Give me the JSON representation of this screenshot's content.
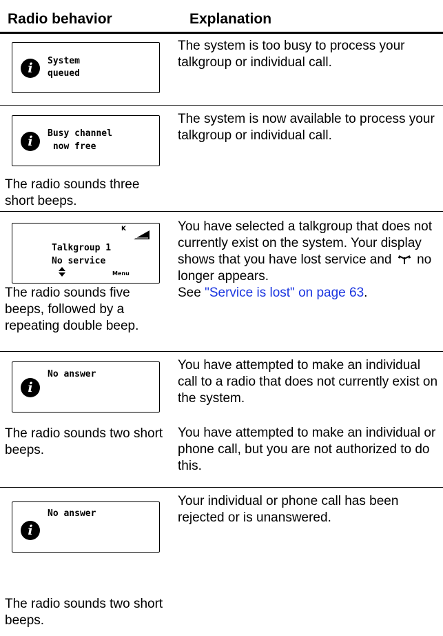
{
  "header": {
    "col1": "Radio behavior",
    "col2": "Explanation"
  },
  "rows": [
    {
      "display": {
        "icon": "info-icon",
        "lines": [
          "System",
          "queued"
        ]
      },
      "behavior": "",
      "explanation": [
        "The system is too busy to process your talkgroup or individual call."
      ]
    },
    {
      "display": {
        "icon": "info-icon",
        "lines": [
          "Busy channel",
          " now free"
        ]
      },
      "behavior": "The radio sounds three short beeps.",
      "explanation": [
        "The system is now available to process your talkgroup or individual call."
      ]
    },
    {
      "display": {
        "icon": "none",
        "lines": [
          "Talkgroup 1",
          "No service"
        ],
        "softkey": "Menu",
        "indicator": "K",
        "status_icons": [
          "signal-strength-icon",
          "navigation-arrows-icon"
        ]
      },
      "behavior": "The radio sounds five beeps, followed by a repeating double beep.",
      "explanation": [
        "You have selected a talkgroup that does not currently exist on the system. Your display shows that you have lost service and",
        "no longer appears."
      ],
      "inline_icon": "antenna-icon",
      "see_prefix": "See ",
      "link_text": "\"Service is lost\" on page 63",
      "see_suffix": "."
    },
    {
      "display": {
        "icon": "info-icon",
        "lines": [
          "No answer"
        ]
      },
      "behavior": "The radio sounds two short beeps.",
      "explanation": [
        "You have attempted to make an individual call to a radio that does not currently exist on the system.",
        "You have attempted to make an individual or phone call, but you are not authorized to do this."
      ]
    },
    {
      "display": {
        "icon": "info-icon",
        "lines": [
          "No answer"
        ]
      },
      "behavior": "The radio sounds two short beeps.",
      "explanation": [
        "Your individual or phone call has been rejected or is unanswered."
      ]
    }
  ],
  "colors": {
    "link": "#1a35e0",
    "rule": "#000000"
  }
}
